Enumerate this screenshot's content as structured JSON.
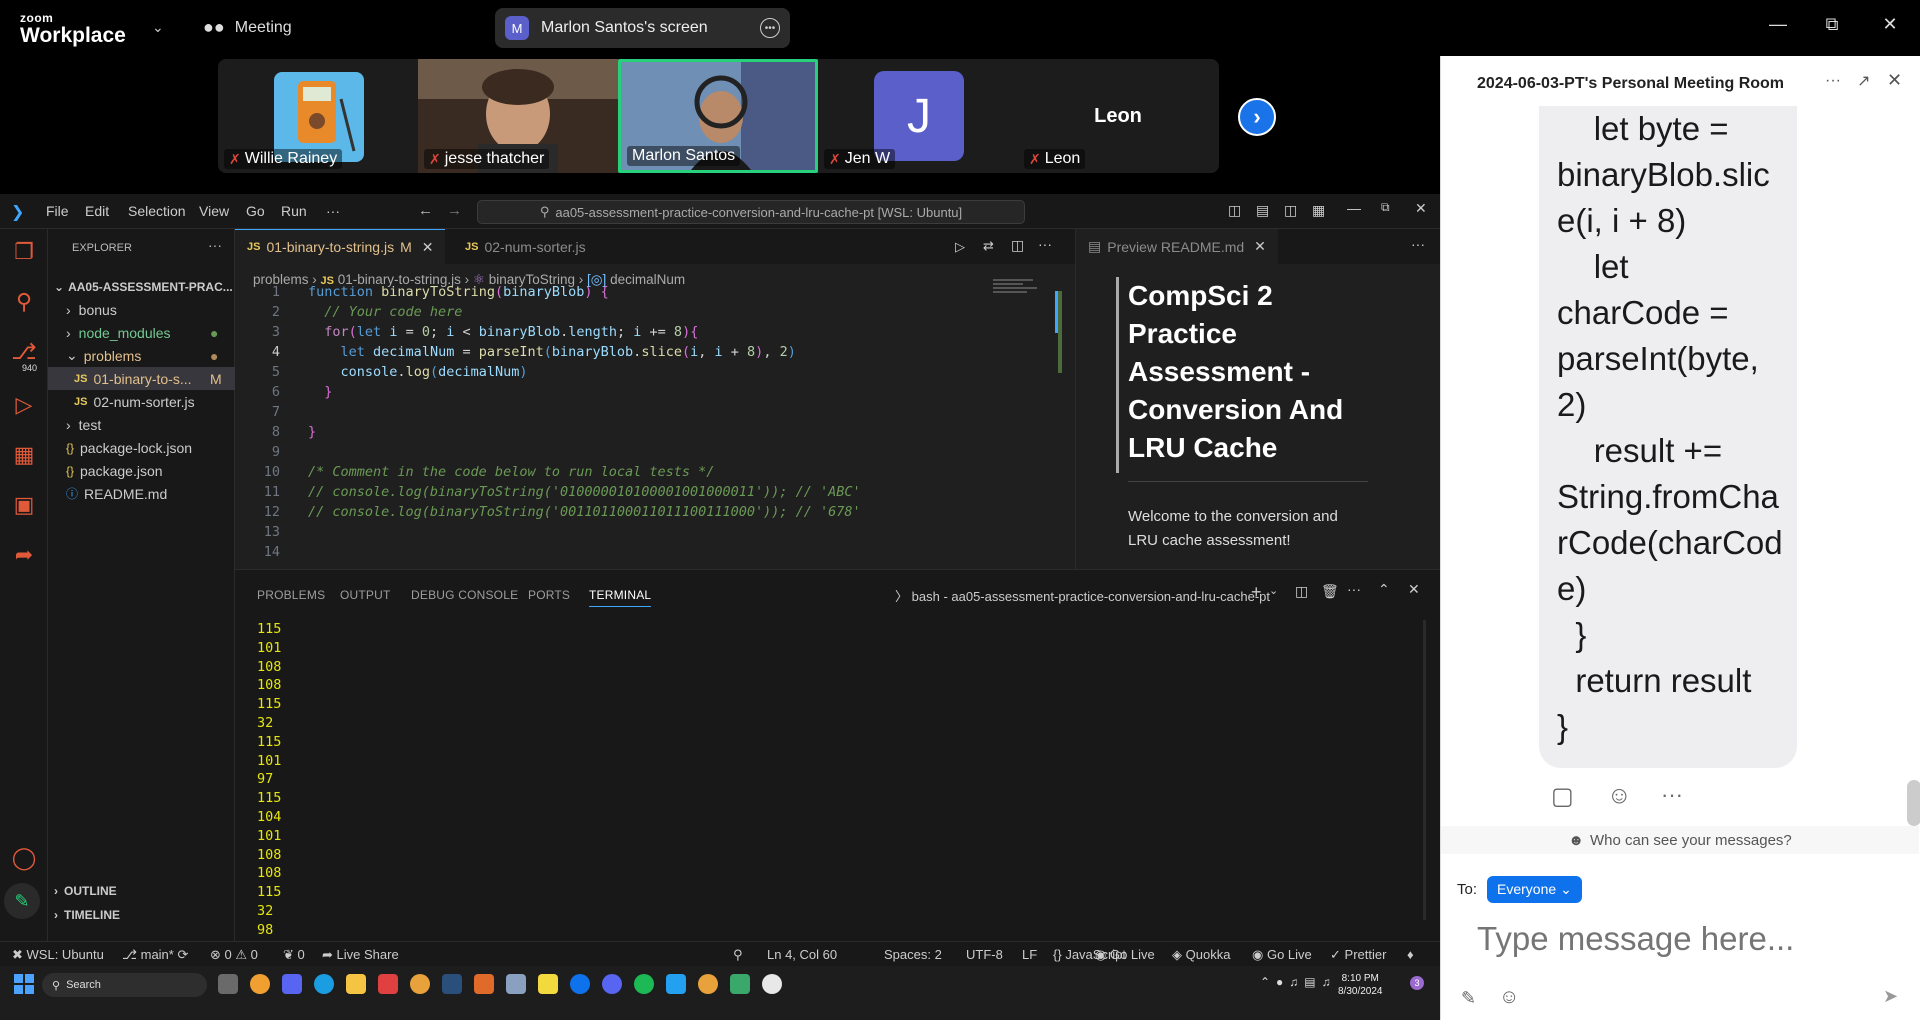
{
  "zoom": {
    "logo_small": "zoom",
    "logo_big": "Workplace",
    "meeting_label": "Meeting",
    "screen_avatar": "M",
    "screen_label": "Marlon Santos's screen"
  },
  "participants": [
    {
      "name": "Willie Rainey"
    },
    {
      "name": "jesse thatcher"
    },
    {
      "name": "Marlon Santos"
    },
    {
      "name": "Jen W",
      "initial": "J"
    },
    {
      "name": "Leon",
      "display": "Leon"
    }
  ],
  "vscode": {
    "menu": [
      "File",
      "Edit",
      "Selection",
      "View",
      "Go",
      "Run",
      "···"
    ],
    "search_text": "aa05-assessment-practice-conversion-and-lru-cache-pt [WSL: Ubuntu]",
    "activity_badge": "940",
    "explorer_title": "EXPLORER",
    "tree": [
      {
        "label": "AA05-ASSESSMENT-PRAC...",
        "type": "root"
      },
      {
        "label": "bonus",
        "type": "folder"
      },
      {
        "label": "node_modules",
        "type": "folder-mod"
      },
      {
        "label": "problems",
        "type": "folder-open"
      },
      {
        "label": "01-binary-to-s...",
        "type": "js-active",
        "flag": "M"
      },
      {
        "label": "02-num-sorter.js",
        "type": "js"
      },
      {
        "label": "test",
        "type": "folder"
      },
      {
        "label": "package-lock.json",
        "type": "json"
      },
      {
        "label": "package.json",
        "type": "json"
      },
      {
        "label": "README.md",
        "type": "info"
      }
    ],
    "outline": "OUTLINE",
    "timeline": "TIMELINE",
    "tabs": [
      {
        "label": "01-binary-to-string.js",
        "flag": "M"
      },
      {
        "label": "02-num-sorter.js"
      }
    ],
    "preview_tab": "Preview README.md",
    "breadcrumb": [
      "problems",
      "01-binary-to-string.js",
      "binaryToString",
      "decimalNum"
    ],
    "line_numbers": [
      "1",
      "2",
      "3",
      "4",
      "5",
      "6",
      "7",
      "8",
      "9",
      "10",
      "11",
      "12",
      "13",
      "14"
    ],
    "preview": {
      "heading": "CompSci 2 Practice Assessment - Conversion And LRU Cache",
      "body": "Welcome to the conversion and LRU cache assessment!"
    },
    "panel_tabs": [
      "PROBLEMS",
      "OUTPUT",
      "DEBUG CONSOLE",
      "PORTS",
      "TERMINAL"
    ],
    "terminal_title": "bash - aa05-assessment-practice-conversion-and-lru-cache-pt",
    "terminal_lines": [
      "115",
      "101",
      "108",
      "108",
      "115",
      "32",
      "115",
      "101",
      "97",
      "115",
      "104",
      "101",
      "108",
      "108",
      "115",
      "32",
      "98"
    ],
    "status": {
      "wsl": "WSL: Ubuntu",
      "branch": "main*",
      "errors": "⊗ 0 ⚠ 0",
      "ports": "0",
      "liveshare": "Live Share",
      "position": "Ln 4, Col 60",
      "spaces": "Spaces: 2",
      "encoding": "UTF-8",
      "eol": "LF",
      "lang": "JavaScript",
      "golive": "Go Live",
      "quokka": "Quokka",
      "golive2": "Go Live",
      "prettier": "Prettier"
    }
  },
  "taskbar": {
    "search": "Search",
    "time": "8:10 PM",
    "date": "8/30/2024",
    "badge": "3"
  },
  "chat": {
    "title": "2024-06-03-PT's Personal Meeting Room",
    "message": "    let byte =\nbinaryBlob.slice(i, i + 8)\n    let\ncharCode =\nparseInt(byte,\n2)\n    result +=\nString.fromCharCode(charCode)\n  }\n  return result\n}",
    "who": "Who can see your messages?",
    "to_label": "To:",
    "recipient": "Everyone",
    "placeholder": "Type message here..."
  },
  "colors": {
    "accent_green": "#27d07a",
    "zoom_blue": "#0e72ed",
    "vscode_bg": "#1f1f1f"
  }
}
